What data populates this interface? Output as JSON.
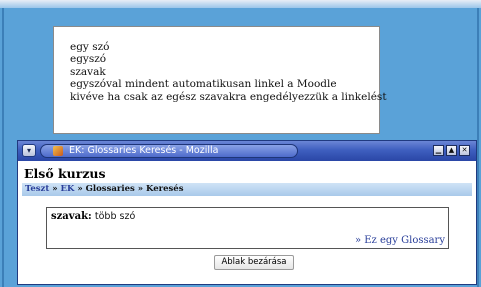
{
  "background_text": {
    "lines": [
      "egy szó",
      "egyszó",
      "szavak",
      "egyszóval mindent automatikusan linkel a Moodle",
      "kivéve ha csak az egész szavakra engedélyezzük a linkelést"
    ]
  },
  "popup": {
    "title": "EK: Glossaries Keresés - Mozilla",
    "buttons": {
      "menu": "▾",
      "minimize": "▁",
      "maximize": "▲",
      "close": "✕"
    },
    "course_title": "Első kurzus",
    "breadcrumb": {
      "item1": "Teszt",
      "sep1": " » ",
      "item2": "EK",
      "sep2": " » ",
      "item3": "Glossaries",
      "sep3": " » ",
      "item4": "Keresés"
    },
    "result": {
      "term": "szavak:",
      "definition": "több szó",
      "glossary_prefix": "» ",
      "glossary_link": "Ez egy Glossary"
    },
    "close_button": "Ablak bezárása"
  },
  "colors": {
    "desktop": "#5aa2d8",
    "titlebar": "#3f5fbf",
    "breadcrumb_bg": "#b9d6f0",
    "link": "#2a3f9a"
  },
  "icons": [
    "window-menu-icon",
    "mozilla-app-icon",
    "minimize-icon",
    "maximize-icon",
    "close-icon"
  ]
}
